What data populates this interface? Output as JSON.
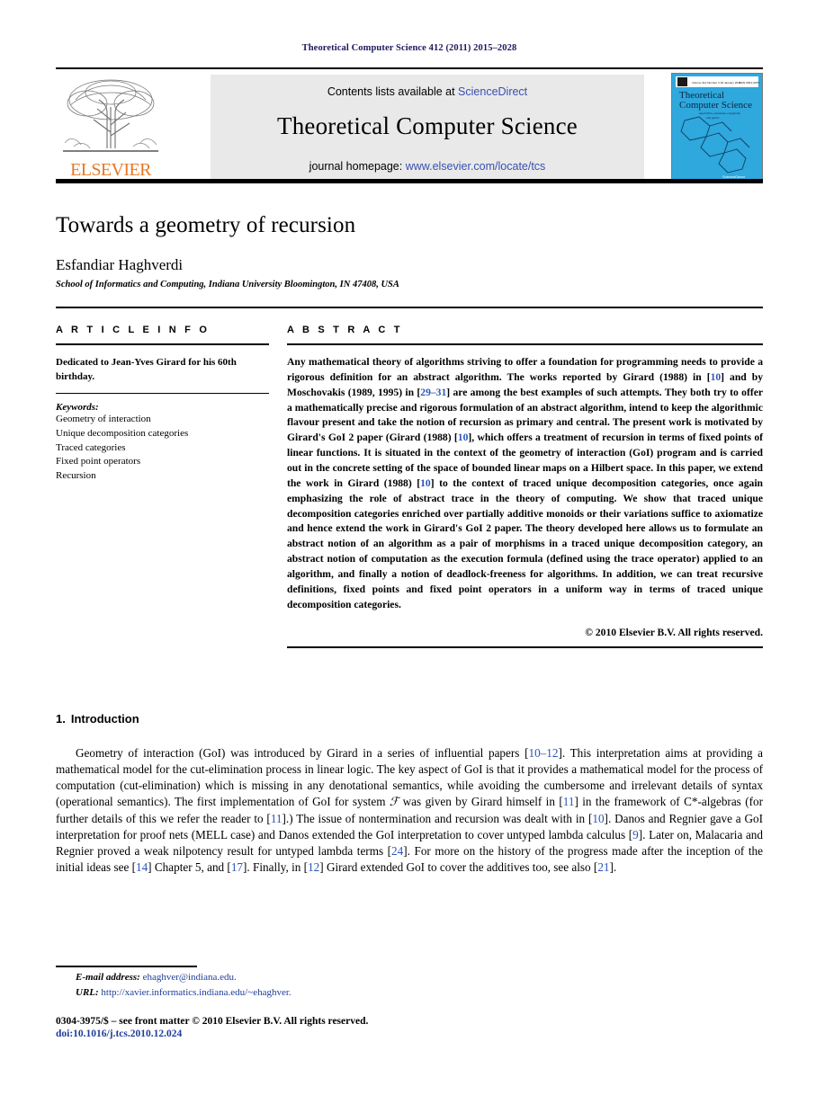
{
  "running_head": "Theoretical Computer Science 412 (2011) 2015–2028",
  "masthead": {
    "contents_prefix": "Contents lists available at ",
    "sciencedirect": "ScienceDirect",
    "journal_name": "Theoretical Computer Science",
    "homepage_prefix": "journal homepage: ",
    "homepage_url": "www.elsevier.com/locate/tcs",
    "publisher_wordmark": "ELSEVIER",
    "cover": {
      "line1": "Theoretical",
      "line2": "Computer Science",
      "tagline": "Algorithms, automata, complexity and games",
      "top_left": "Volume 412 Number 3 18 January 2011",
      "top_right": "ISSN 0304-3975",
      "bottom_mark": "ScienceDirect"
    },
    "link_color": "#3a4fb0",
    "brand_color": "#e87722",
    "cover_color": "#2ea8dd"
  },
  "title": "Towards a geometry of recursion",
  "author": "Esfandiar Haghverdi",
  "affiliation": "School of Informatics and Computing, Indiana University Bloomington, IN 47408, USA",
  "article_info": {
    "label": "A R T I C L E    I N F O",
    "dedication": "Dedicated to Jean-Yves Girard for his 60th birthday.",
    "keywords_label": "Keywords:",
    "keywords": [
      "Geometry of interaction",
      "Unique decomposition categories",
      "Traced categories",
      "Fixed point operators",
      "Recursion"
    ]
  },
  "abstract": {
    "label": "A B S T R A C T",
    "part1": "Any mathematical theory of algorithms striving to offer a foundation for programming needs to provide a rigorous definition for an abstract algorithm. The works reported by Girard (1988) in [",
    "cit1": "10",
    "part2": "] and by Moschovakis (1989, 1995) in [",
    "cit2": "29–31",
    "part3": "] are among the best examples of such attempts. They both try to offer a mathematically precise and rigorous formulation of an abstract algorithm, intend to keep the algorithmic flavour present and take the notion of recursion as primary and central. The present work is motivated by Girard's GoI 2 paper (Girard (1988) [",
    "cit3": "10",
    "part4": "], which offers a treatment of recursion in terms of fixed points of linear functions. It is situated in the context of the geometry of interaction (GoI) program and is carried out in the concrete setting of the space of bounded linear maps on a Hilbert space. In this paper, we extend the work in Girard (1988) [",
    "cit4": "10",
    "part5": "] to the context of traced unique decomposition categories, once again emphasizing the role of abstract trace in the theory of computing. We show that traced unique decomposition categories enriched over partially additive monoids or their variations suffice to axiomatize and hence extend the work in Girard's GoI 2 paper. The theory developed here allows us to formulate an abstract notion of an algorithm as a pair of morphisms in a traced unique decomposition category, an abstract notion of computation as the execution formula (defined using the trace operator) applied to an algorithm, and finally a notion of deadlock-freeness for algorithms. In addition, we can treat recursive definitions, fixed points and fixed point operators in a uniform way in terms of traced unique decomposition categories.",
    "copyright": "© 2010 Elsevier B.V. All rights reserved."
  },
  "introduction": {
    "number": "1.",
    "heading": "Introduction",
    "p1_a": "Geometry of interaction (GoI) was introduced by Girard in a series of influential papers [",
    "p1_cit1": "10–12",
    "p1_b": "]. This interpretation aims at providing a mathematical model for the cut-elimination process in linear logic. The key aspect of GoI is that it provides a mathematical model for the process of computation (cut-elimination) which is missing in any denotational semantics, while avoiding the cumbersome and irrelevant details of syntax (operational semantics). The first implementation of GoI for system ",
    "p1_script": "ℱ",
    "p1_c": " was given by Girard himself in [",
    "p1_cit2": "11",
    "p1_d": "] in the framework of C*-algebras (for further details of this we refer the reader to [",
    "p1_cit3": "11",
    "p1_e": "].) The issue of nontermination and recursion was dealt with in [",
    "p1_cit4": "10",
    "p1_f": "]. Danos and Regnier gave a GoI interpretation for proof nets (MELL case) and Danos extended the GoI interpretation to cover untyped lambda calculus [",
    "p1_cit5": "9",
    "p1_g": "]. Later on, Malacaria and Regnier proved a weak nilpotency result for untyped lambda terms [",
    "p1_cit6": "24",
    "p1_h": "]. For more on the history of the progress made after the inception of the initial ideas see [",
    "p1_cit7": "14",
    "p1_i": "] Chapter 5, and [",
    "p1_cit8": "17",
    "p1_j": "]. Finally, in [",
    "p1_cit9": "12",
    "p1_k": "] Girard extended GoI to cover the additives too, see also [",
    "p1_cit10": "21",
    "p1_l": "]."
  },
  "footer": {
    "email_label": "E-mail address:",
    "email": "ehaghver@indiana.edu.",
    "url_label": "URL:",
    "url": "http://xavier.informatics.indiana.edu/~ehaghver.",
    "imprint": "0304-3975/$ – see front matter © 2010 Elsevier B.V. All rights reserved.",
    "doi": "doi:10.1016/j.tcs.2010.12.024"
  }
}
